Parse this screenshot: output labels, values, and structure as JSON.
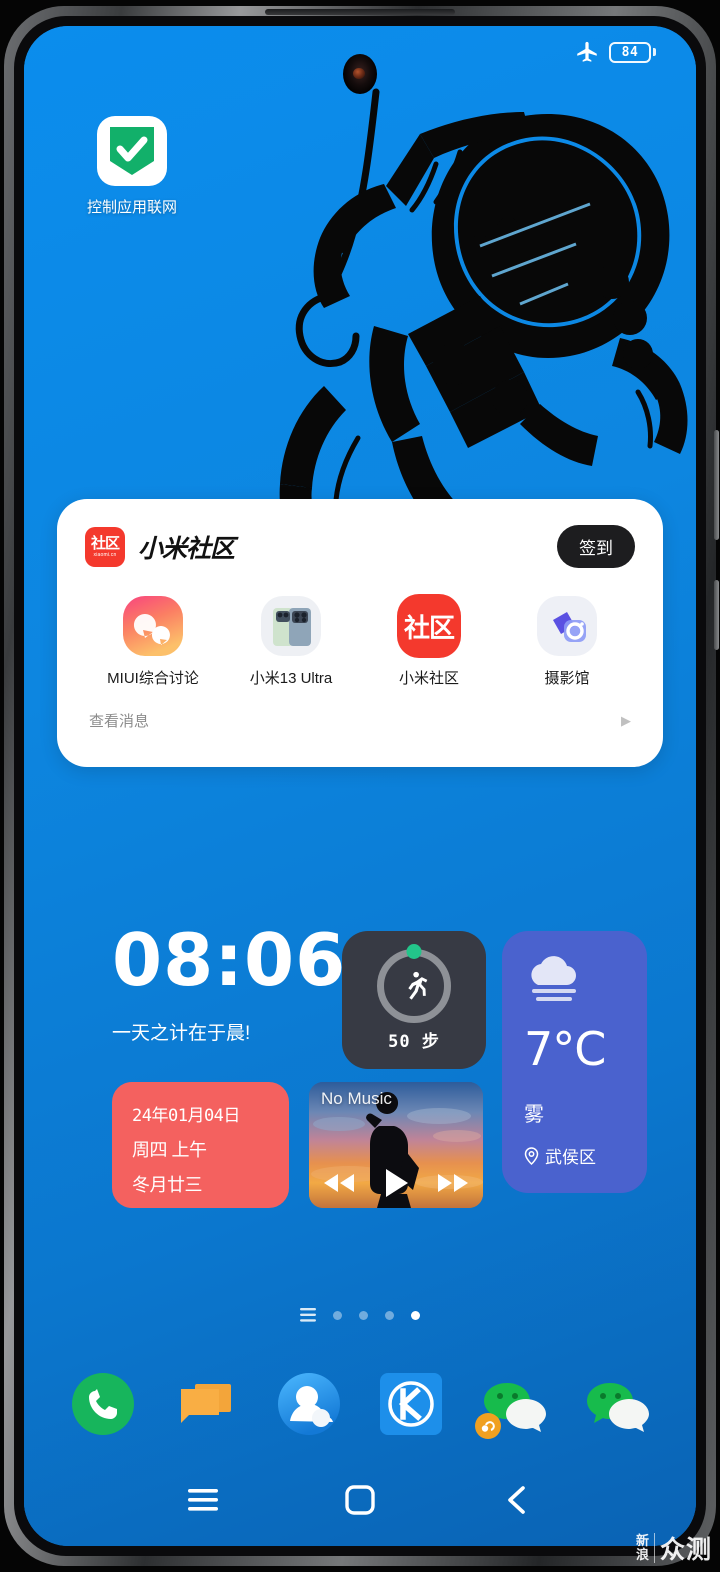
{
  "status_bar": {
    "airplane_icon": "airplane-mode-icon",
    "battery_level": "84",
    "battery_icon": "battery-icon"
  },
  "wallpaper": {
    "description": "astronaut-line-art",
    "background_color": "#0b8ded"
  },
  "home_screen": {
    "app_shortcut": {
      "icon": "shield-check-icon",
      "label": "控制应用联网",
      "icon_color": "#12b06a"
    },
    "community_widget": {
      "logo_top": "社区",
      "logo_bottom": "xiaomi.cn",
      "title": "小米社区",
      "signin_label": "签到",
      "apps": [
        {
          "label": "MIUI综合讨论",
          "icon": "miui-discussion-icon"
        },
        {
          "label": "小米13 Ultra",
          "icon": "xiaomi-13-ultra-icon"
        },
        {
          "label": "小米社区",
          "icon": "xiaomi-community-icon"
        },
        {
          "label": "摄影馆",
          "icon": "photography-gallery-icon"
        }
      ],
      "footer_label": "查看消息",
      "footer_arrow": "▶",
      "accent_color": "#f4392d",
      "signin_bg": "#1d1d1f"
    },
    "clock_widget": {
      "time": "08:06",
      "subtitle": "一天之计在于晨!"
    },
    "steps_widget": {
      "icon": "running-person-icon",
      "count": "50 步",
      "bg_color": "#373a44",
      "dot_color": "#23c58a"
    },
    "weather_widget": {
      "icon": "fog-cloud-icon",
      "temperature": "7°C",
      "condition": "雾",
      "location": "武侯区",
      "location_icon": "location-pin-icon",
      "bg_color": "#4a62ce"
    },
    "date_widget": {
      "line1": "24年01月04日",
      "line2": "周四 上午",
      "line3": "冬月廿三",
      "bg_color": "#f4615f"
    },
    "music_widget": {
      "title": "No Music",
      "prev_icon": "previous-track-icon",
      "play_icon": "play-icon",
      "next_icon": "next-track-icon"
    },
    "page_indicator": {
      "menu_icon": "pages-menu-icon",
      "dots": 4,
      "active_index": 3
    }
  },
  "dock": {
    "items": [
      {
        "name": "phone",
        "icon": "phone-icon",
        "color": "#17b55c"
      },
      {
        "name": "messages",
        "icon": "messages-icon",
        "color": "#f5a623"
      },
      {
        "name": "contacts",
        "icon": "contacts-icon",
        "color": "#2196f3"
      },
      {
        "name": "kuaishou",
        "icon": "k-app-icon",
        "color": "#1d8fea",
        "letter": "K"
      },
      {
        "name": "wechat-dual",
        "icon": "wechat-icon",
        "color": "#1aad19",
        "badge": "dual-app-badge"
      },
      {
        "name": "wechat",
        "icon": "wechat-icon",
        "color": "#1aad19"
      }
    ]
  },
  "nav_bar": {
    "recents_icon": "recents-menu-icon",
    "home_icon": "home-square-icon",
    "back_icon": "back-chevron-icon"
  },
  "watermark": {
    "left_top": "新",
    "left_bottom": "浪",
    "right": "众测"
  }
}
